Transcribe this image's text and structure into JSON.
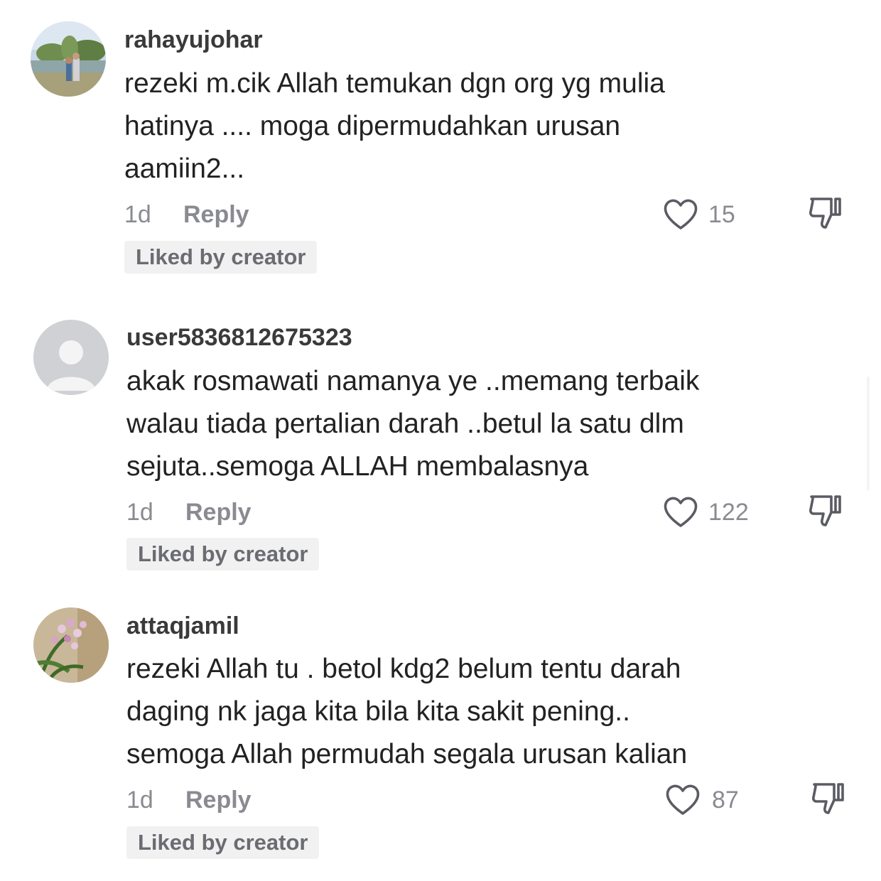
{
  "comments": [
    {
      "username": "rahayujohar",
      "avatar": "profile-photo-outdoor",
      "lines": [
        "rezeki m.cik Allah temukan dgn org yg mulia",
        "hatinya .... moga dipermudahkan urusan",
        "aamiin2..."
      ],
      "time": "1d",
      "reply_label": "Reply",
      "likes": "15",
      "badge": "Liked by creator"
    },
    {
      "username": "user5836812675323",
      "avatar": "default-avatar",
      "lines": [
        "akak rosmawati namanya ye ..memang terbaik",
        "walau tiada pertalian darah ..betul la satu dlm",
        "sejuta..semoga ALLAH membalasnya"
      ],
      "time": "1d",
      "reply_label": "Reply",
      "likes": "122",
      "badge": "Liked by creator"
    },
    {
      "username": "attaqjamil",
      "avatar": "profile-photo-orchid",
      "lines": [
        "rezeki Allah tu . betol kdg2 belum tentu darah",
        "daging nk jaga kita bila kita sakit pening..",
        "semoga Allah permudah segala urusan kalian"
      ],
      "time": "1d",
      "reply_label": "Reply",
      "likes": "87",
      "badge": "Liked by creator"
    }
  ],
  "icons": {
    "like": "heart-outline-icon",
    "dislike": "thumbs-down-icon"
  },
  "colors": {
    "text": "#222222",
    "muted": "#8a8b91",
    "badge_bg": "#f1f1f2"
  }
}
